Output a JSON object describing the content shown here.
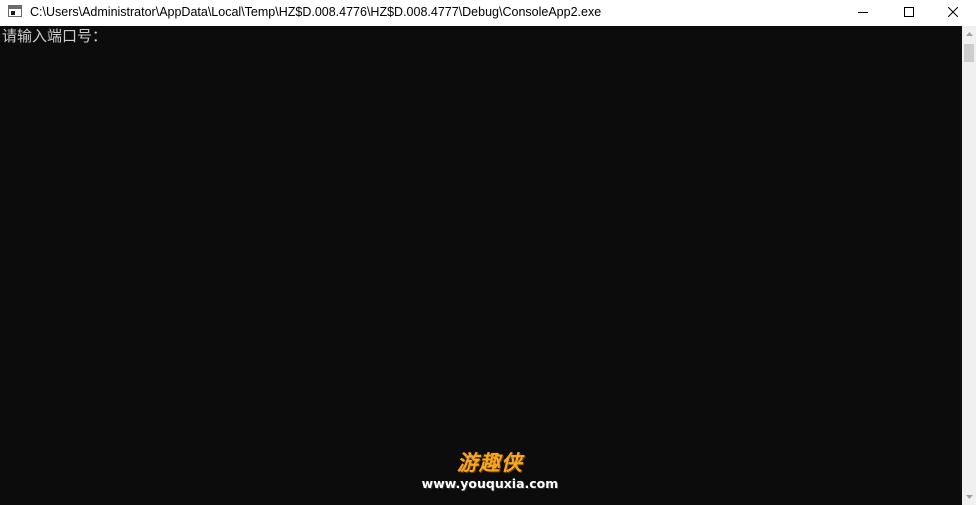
{
  "window": {
    "title": "C:\\Users\\Administrator\\AppData\\Local\\Temp\\HZ$D.008.4776\\HZ$D.008.4777\\Debug\\ConsoleApp2.exe",
    "icon": "console-app-icon",
    "controls": {
      "minimize": "minimize-icon",
      "maximize": "maximize-icon",
      "close": "close-icon"
    }
  },
  "console": {
    "background": "#0c0c0c",
    "text_color": "#cccccc",
    "prompt": "请输入端口号："
  },
  "watermark": {
    "logo": "游趣侠",
    "url": "www.youquxia.com",
    "logo_color": "#f5a623"
  }
}
